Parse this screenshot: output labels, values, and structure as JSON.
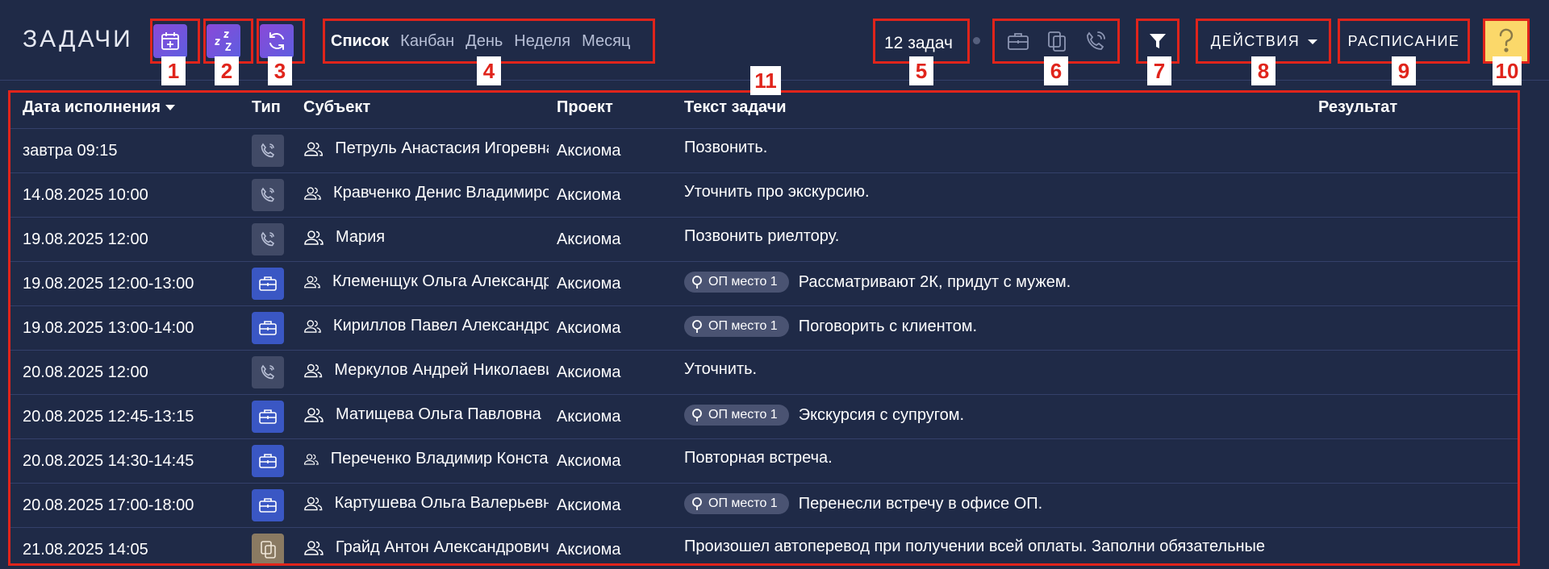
{
  "header": {
    "title": "ЗАДАЧИ",
    "views": [
      {
        "label": "Список",
        "active": true
      },
      {
        "label": "Канбан",
        "active": false
      },
      {
        "label": "День",
        "active": false
      },
      {
        "label": "Неделя",
        "active": false
      },
      {
        "label": "Месяц",
        "active": false
      }
    ],
    "task_count": "12 задач",
    "actions_label": "ДЕЙСТВИЯ",
    "schedule_label": "РАСПИСАНИЕ"
  },
  "markers": [
    "1",
    "2",
    "3",
    "4",
    "5",
    "6",
    "7",
    "8",
    "9",
    "10",
    "11"
  ],
  "table": {
    "columns": {
      "date": "Дата исполнения",
      "type": "Тип",
      "subject": "Субъект",
      "project": "Проект",
      "text": "Текст задачи",
      "result": "Результат"
    },
    "rows": [
      {
        "date": "завтра 09:15",
        "type": "call",
        "subject": "Петруль Анастасия Игоревна",
        "project": "Аксиома",
        "badge": "",
        "text": "Позвонить.",
        "result": ""
      },
      {
        "date": "14.08.2025 10:00",
        "type": "call",
        "subject": "Кравченко Денис Владимирович",
        "project": "Аксиома",
        "badge": "",
        "text": "Уточнить про экскурсию.",
        "result": ""
      },
      {
        "date": "19.08.2025 12:00",
        "type": "call",
        "subject": "Мария",
        "project": "Аксиома",
        "badge": "",
        "text": "Позвонить риелтору.",
        "result": ""
      },
      {
        "date": "19.08.2025 12:00-13:00",
        "type": "meeting",
        "subject": "Клеменщук Ольга Александровна",
        "project": "Аксиома",
        "badge": "ОП место 1",
        "text": "Рассматривают 2К, придут с мужем.",
        "result": ""
      },
      {
        "date": "19.08.2025 13:00-14:00",
        "type": "meeting",
        "subject": "Кириллов Павел Александрович",
        "project": "Аксиома",
        "badge": "ОП место 1",
        "text": "Поговорить с клиентом.",
        "result": ""
      },
      {
        "date": "20.08.2025 12:00",
        "type": "call",
        "subject": "Меркулов Андрей Николаевич",
        "project": "Аксиома",
        "badge": "",
        "text": "Уточнить.",
        "result": ""
      },
      {
        "date": "20.08.2025 12:45-13:15",
        "type": "meeting",
        "subject": "Матищева Ольга Павловна",
        "project": "Аксиома",
        "badge": "ОП место 1",
        "text": "Экскурсия с супругом.",
        "result": ""
      },
      {
        "date": "20.08.2025 14:30-14:45",
        "type": "meeting",
        "subject": "Переченко Владимир Константинович",
        "project": "Аксиома",
        "badge": "",
        "text": "Повторная встреча.",
        "result": ""
      },
      {
        "date": "20.08.2025 17:00-18:00",
        "type": "meeting",
        "subject": "Картушева Ольга Валерьевна",
        "project": "Аксиома",
        "badge": "ОП место 1",
        "text": "Перенесли встречу в офисе ОП.",
        "result": ""
      },
      {
        "date": "21.08.2025 14:05",
        "type": "document",
        "subject": "Грайд Антон Александрович",
        "project": "Аксиома",
        "badge": "",
        "text": "Произошел автоперевод при получении всей оплаты. Заполни обязательные",
        "result": ""
      }
    ]
  },
  "colors": {
    "background": "#1f2a47",
    "accent_gradient_start": "#8a49d8",
    "accent_gradient_end": "#5d5ee0",
    "meeting_type": "#3a57c4",
    "call_type": "#414a66",
    "document_type": "#8a7a62",
    "help_button": "#fbd86a",
    "annotation_red": "#e0241b"
  }
}
